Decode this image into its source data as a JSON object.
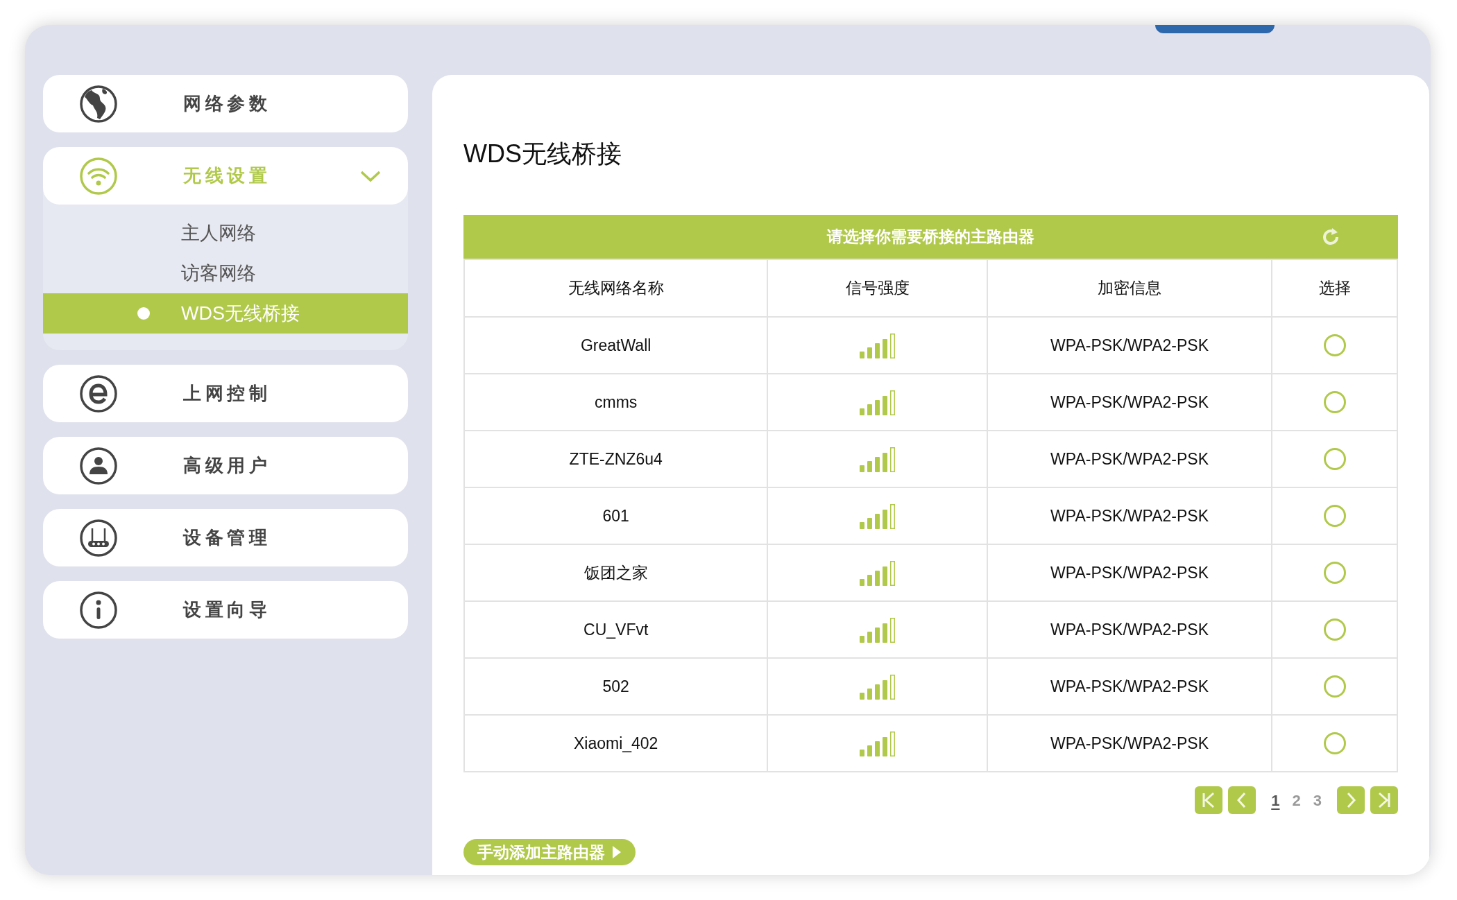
{
  "sidebar": {
    "items": [
      {
        "label": "网络参数",
        "expanded": false
      },
      {
        "label": "无线设置",
        "expanded": true,
        "children": [
          {
            "label": "主人网络",
            "selected": false
          },
          {
            "label": "访客网络",
            "selected": false
          },
          {
            "label": "WDS无线桥接",
            "selected": true
          }
        ]
      },
      {
        "label": "上网控制",
        "expanded": false
      },
      {
        "label": "高级用户",
        "expanded": false
      },
      {
        "label": "设备管理",
        "expanded": false
      },
      {
        "label": "设置向导",
        "expanded": false
      }
    ]
  },
  "page_title": "WDS无线桥接",
  "table": {
    "caption": "请选择你需要桥接的主路由器",
    "columns": [
      "无线网络名称",
      "信号强度",
      "加密信息",
      "选择"
    ],
    "rows": [
      {
        "ssid": "GreatWall",
        "security": "WPA-PSK/WPA2-PSK",
        "selected": false
      },
      {
        "ssid": "cmms",
        "security": "WPA-PSK/WPA2-PSK",
        "selected": false
      },
      {
        "ssid": "ZTE-ZNZ6u4",
        "security": "WPA-PSK/WPA2-PSK",
        "selected": false
      },
      {
        "ssid": "601",
        "security": "WPA-PSK/WPA2-PSK",
        "selected": false
      },
      {
        "ssid": "饭团之家",
        "security": "WPA-PSK/WPA2-PSK",
        "selected": false
      },
      {
        "ssid": "CU_VFvt",
        "security": "WPA-PSK/WPA2-PSK",
        "selected": false
      },
      {
        "ssid": "502",
        "security": "WPA-PSK/WPA2-PSK",
        "selected": false
      },
      {
        "ssid": "Xiaomi_402",
        "security": "WPA-PSK/WPA2-PSK",
        "selected": false
      }
    ]
  },
  "pagination": {
    "pages": [
      {
        "label": "1",
        "selected": true
      },
      {
        "label": "2",
        "selected": false
      },
      {
        "label": "3",
        "selected": false
      }
    ]
  },
  "add_button": {
    "label": "手动添加主路由器"
  }
}
